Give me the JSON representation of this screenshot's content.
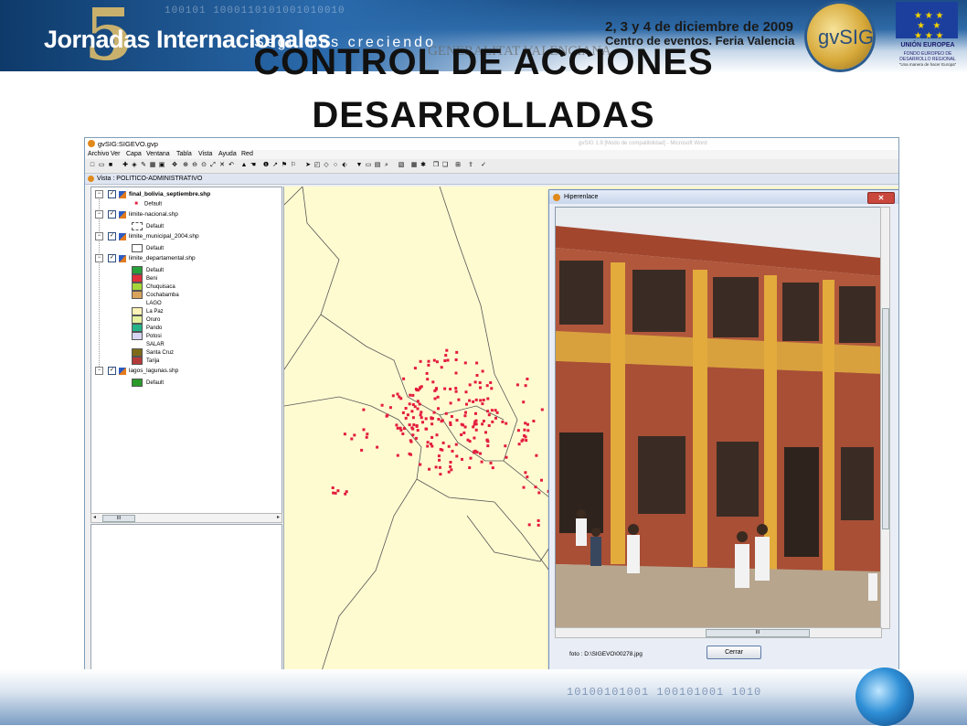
{
  "slide": {
    "banner_name": "Jornadas Internacionales",
    "banner_tagline": "Seguimos creciendo",
    "edition_number": "5",
    "edition_suffix": "as",
    "event_dates": "2, 3 y 4 de diciembre de 2009",
    "event_place": "Centro de eventos. Feria Valencia",
    "gva_logo": "GENERALITAT VALENCIANA",
    "gvsig_logo": "gvSIG",
    "eu_title": "UNIÓN EUROPEA",
    "eu_fund": "FONDO EUROPEO DE DESARROLLO REGIONAL",
    "eu_slogan": "\"Una manera de hacer Europa\"",
    "title_line1": "CONTROL DE ACCIONES",
    "title_line2": "DESARROLLADAS",
    "binary_top": "100101 1000110101001010010",
    "binary_bottom": "10100101001 100101001 1010"
  },
  "app": {
    "title": "gvSIG:SIGEVO.gvp",
    "faded_title": "gvSIG 1.9 [Modo de compatibilidad] - Microsoft Word",
    "menu": [
      "Archivo",
      "Ver",
      "Capa",
      "Ventana",
      "Tabla",
      "Vista",
      "Ayuda",
      "Red"
    ],
    "view_title": "Vista : POLITICO-ADMINISTRATIVO",
    "layers": [
      {
        "name": "final_bolivia_septiembre.shp",
        "bold": true,
        "legend": [
          {
            "label": "Default",
            "type": "dot",
            "color": "#e31c3d"
          }
        ]
      },
      {
        "name": "limite-nacional.shp",
        "legend": [
          {
            "label": "Default",
            "type": "dashed",
            "color": "#ffffff"
          }
        ]
      },
      {
        "name": "limite_municipal_2004.shp",
        "legend": [
          {
            "label": "Default",
            "type": "box",
            "color": "#ffffff"
          }
        ]
      },
      {
        "name": "limite_departamental.shp",
        "legend": [
          {
            "label": "Default",
            "type": "box",
            "color": "#27a13a"
          },
          {
            "label": "Beni",
            "type": "box",
            "color": "#e0303a"
          },
          {
            "label": "Chuquisaca",
            "type": "box",
            "color": "#a6d63a"
          },
          {
            "label": "Cochabamba",
            "type": "box",
            "color": "#d9a25a"
          },
          {
            "label": "LAGO",
            "type": "none",
            "color": ""
          },
          {
            "label": "La Paz",
            "type": "box",
            "color": "#fff3b8"
          },
          {
            "label": "Oruro",
            "type": "box",
            "color": "#e7f2a0"
          },
          {
            "label": "Pando",
            "type": "box",
            "color": "#27b38a"
          },
          {
            "label": "Potosi",
            "type": "box",
            "color": "#d6d6f4"
          },
          {
            "label": "SALAR",
            "type": "none",
            "color": ""
          },
          {
            "label": "Santa Cruz",
            "type": "box",
            "color": "#7d6b1a"
          },
          {
            "label": "Tarija",
            "type": "box",
            "color": "#b53a3a"
          }
        ]
      },
      {
        "name": "lagos_lagunas.shp",
        "legend": [
          {
            "label": "Default",
            "type": "box",
            "color": "#2a9a2a"
          }
        ]
      }
    ],
    "scroll_thumb": "III",
    "map": {
      "background": "#fffbd1",
      "point_color": "#e31c3d",
      "line_color": "#555555"
    },
    "popup": {
      "title": "Hiperenlace",
      "close_symbol": "✕",
      "photo_path": "foto : D:\\SIGEVO\\00278.jpg",
      "button": "Cerrar"
    }
  }
}
